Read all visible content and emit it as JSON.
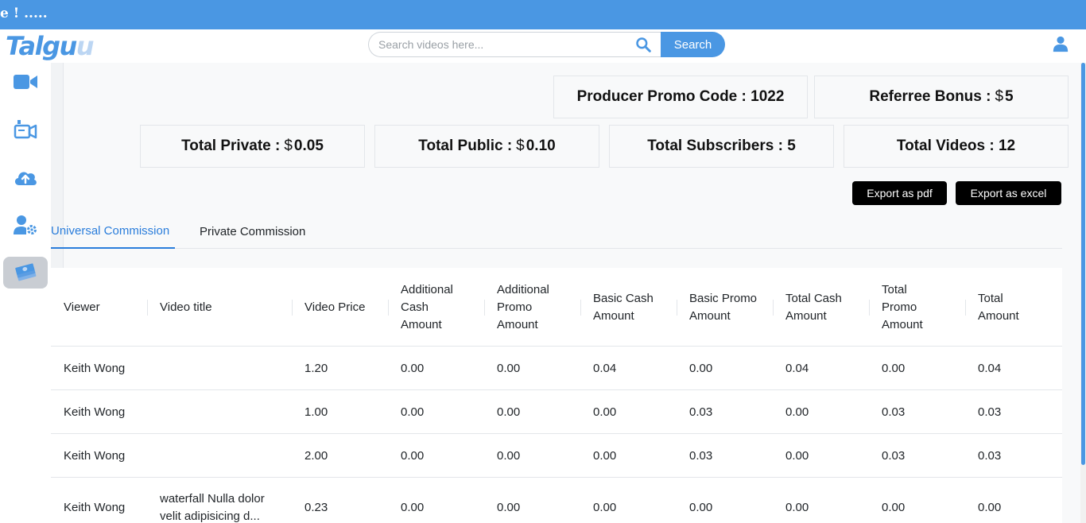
{
  "ticker": {
    "text": "e ! ....."
  },
  "logo": {
    "main": "Talgu",
    "tail": "u"
  },
  "search": {
    "placeholder": "Search videos here...",
    "button_label": "Search"
  },
  "icons": {
    "search": "search-icon",
    "user": "user-icon",
    "sidebar": [
      "video-camera-icon",
      "video-upload-camera-icon",
      "cloud-upload-icon",
      "user-settings-icon",
      "money-stack-icon"
    ]
  },
  "colors": {
    "accent": "#4a97e3",
    "active_tab": "#2a7ddb",
    "button_dark": "#000000",
    "sidebar_active": "#c9cdd3"
  },
  "stats": {
    "producer_promo": {
      "label": "Producer Promo Code :",
      "value": "1022"
    },
    "referree_bonus": {
      "label": "Referree Bonus :",
      "currency": "$",
      "value": "5"
    },
    "total_private": {
      "label": "Total Private :",
      "currency": "$",
      "value": "0.05"
    },
    "total_public": {
      "label": "Total Public :",
      "currency": "$",
      "value": "0.10"
    },
    "total_subscribers": {
      "label": "Total Subscribers :",
      "value": "5"
    },
    "total_videos": {
      "label": "Total Videos :",
      "value": "12"
    }
  },
  "export": {
    "pdf": "Export as pdf",
    "excel": "Export as excel"
  },
  "tabs": [
    {
      "label": "Universal Commission",
      "active": true
    },
    {
      "label": "Private Commission",
      "active": false
    }
  ],
  "table": {
    "headers": [
      "Viewer",
      "Video title",
      "Video Price",
      "Additional Cash Amount",
      "Additional Promo Amount",
      "Basic Cash Amount",
      "Basic Promo Amount",
      "Total Cash Amount",
      "Total Promo Amount",
      "Total Amount"
    ],
    "rows": [
      [
        "Keith Wong",
        "",
        "1.20",
        "0.00",
        "0.00",
        "0.04",
        "0.00",
        "0.04",
        "0.00",
        "0.04"
      ],
      [
        "Keith Wong",
        "",
        "1.00",
        "0.00",
        "0.00",
        "0.00",
        "0.03",
        "0.00",
        "0.03",
        "0.03"
      ],
      [
        "Keith Wong",
        "",
        "2.00",
        "0.00",
        "0.00",
        "0.00",
        "0.03",
        "0.00",
        "0.03",
        "0.03"
      ],
      [
        "Keith Wong",
        "waterfall Nulla dolor velit adipisicing d...",
        "0.23",
        "0.00",
        "0.00",
        "0.00",
        "0.00",
        "0.00",
        "0.00",
        "0.00"
      ]
    ]
  }
}
